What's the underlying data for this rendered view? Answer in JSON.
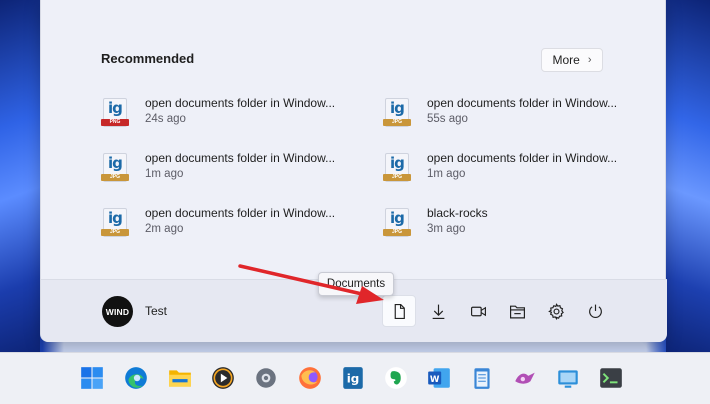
{
  "recommended": {
    "title": "Recommended",
    "more_label": "More",
    "items": [
      {
        "name": "open documents folder in Window...",
        "time": "24s ago",
        "type": "PNG",
        "color": "#c62828"
      },
      {
        "name": "open documents folder in Window...",
        "time": "55s ago",
        "type": "JPG",
        "color": "#c9963a"
      },
      {
        "name": "open documents folder in Window...",
        "time": "1m ago",
        "type": "JPG",
        "color": "#c9963a"
      },
      {
        "name": "open documents folder in Window...",
        "time": "1m ago",
        "type": "JPG",
        "color": "#c9963a"
      },
      {
        "name": "open documents folder in Window...",
        "time": "2m ago",
        "type": "JPG",
        "color": "#c9963a"
      },
      {
        "name": "black-rocks",
        "time": "3m ago",
        "type": "JPG",
        "color": "#c9963a"
      }
    ]
  },
  "user": {
    "avatar_text": "WIND",
    "name": "Test"
  },
  "tooltip": {
    "text": "Documents"
  },
  "footer_icons": [
    "documents-icon",
    "downloads-icon",
    "videos-icon",
    "file-explorer-icon",
    "settings-icon",
    "power-icon"
  ],
  "taskbar_icons": [
    "start-icon",
    "edge-icon",
    "file-explorer-icon",
    "media-player-icon",
    "settings-icon",
    "firefox-icon",
    "irfanview-icon",
    "evernote-icon",
    "word-icon",
    "notepad-icon",
    "azure-data-studio-icon",
    "remote-desktop-icon",
    "terminal-icon"
  ],
  "colors": {
    "accent": "#0067c0",
    "arrow": "#e0262a"
  }
}
